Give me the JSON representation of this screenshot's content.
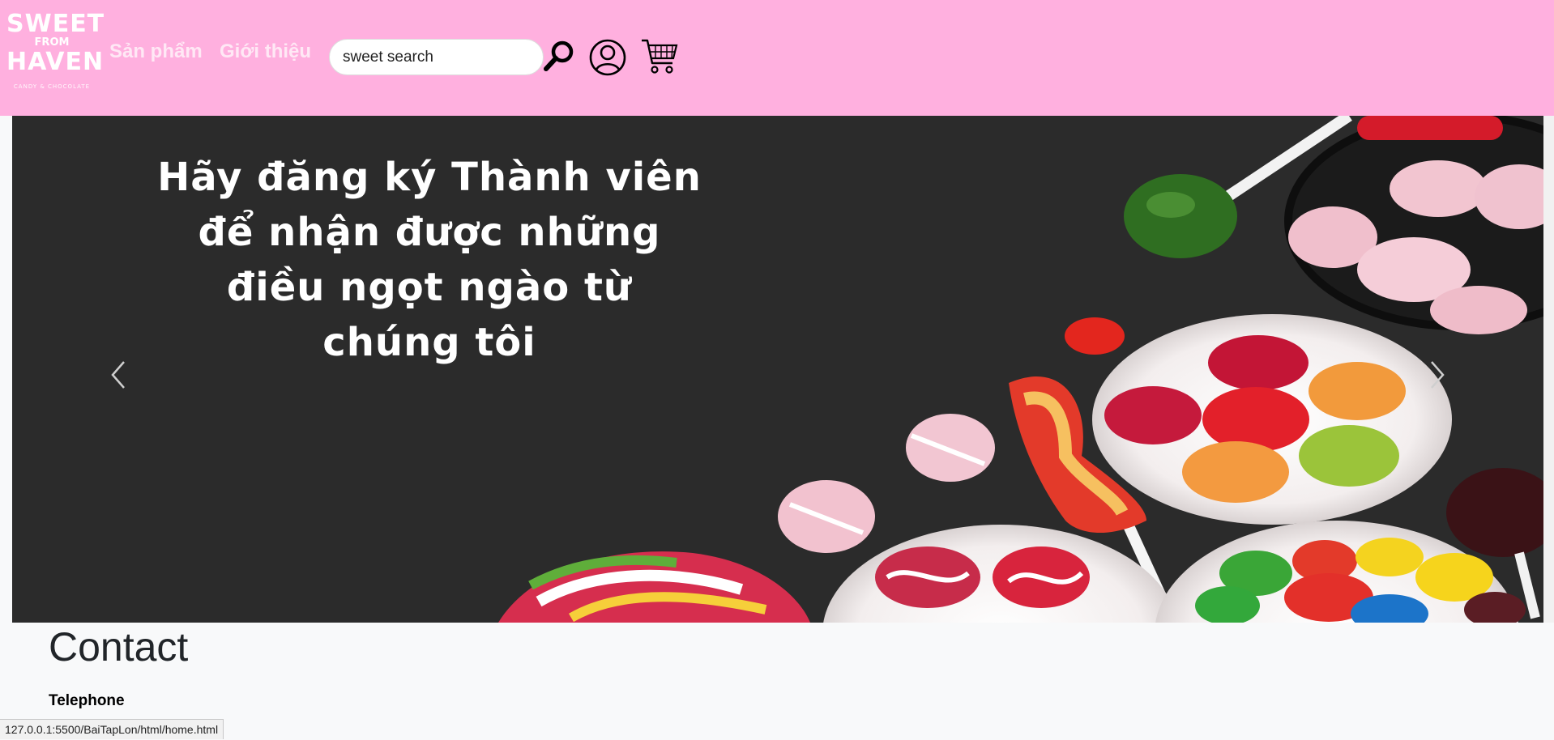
{
  "logo": {
    "line1": "SWEET",
    "line2": "FROM",
    "line3": "HAVEN",
    "tagline": "CANDY & CHOCOLATE"
  },
  "nav": {
    "products": "Sản phẩm",
    "about": "Giới thiệu"
  },
  "search": {
    "value": "sweet search",
    "placeholder": "sweet search"
  },
  "icons": {
    "search": "search-icon",
    "account": "user-icon",
    "cart": "cart-icon"
  },
  "carousel": {
    "lines": [
      "Hãy đăng ký Thành viên",
      "để nhận được những",
      "điều ngọt ngào từ",
      "chúng tôi"
    ]
  },
  "contact": {
    "title": "Contact",
    "telephone_label": "Telephone"
  },
  "status_bar": {
    "url": "127.0.0.1:5500/BaiTapLon/html/home.html"
  },
  "colors": {
    "header_bg": "#ffb0df",
    "hero_bg": "#2b2b2b"
  }
}
